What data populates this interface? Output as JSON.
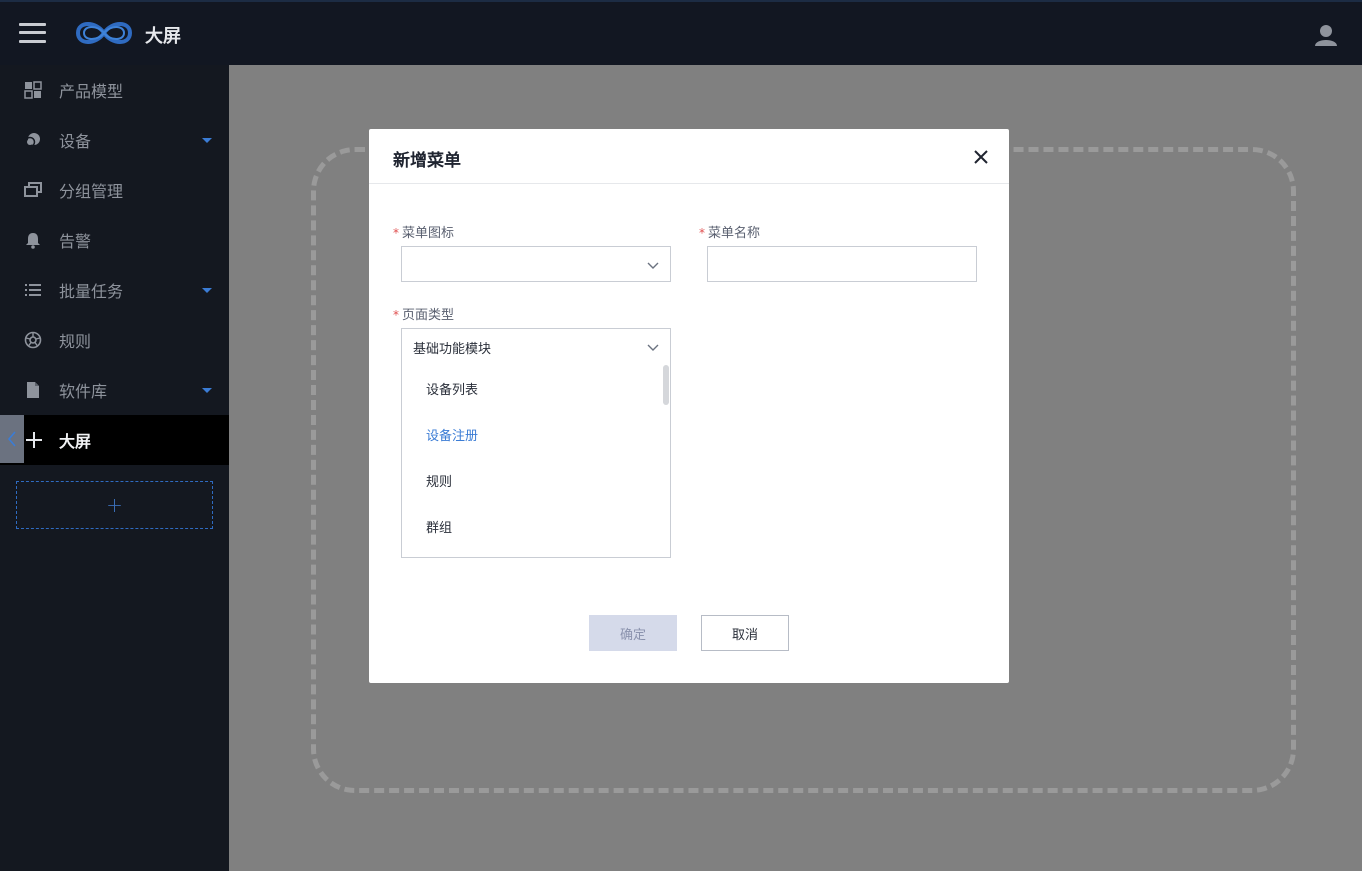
{
  "header": {
    "brand": "大屏",
    "menu_icon": "hamburger-icon",
    "logo_icon": "infinity-logo-icon",
    "user_icon": "user-avatar-icon"
  },
  "sidebar": {
    "items": [
      {
        "label": "产品模型",
        "icon": "grid-icon",
        "has_submenu": false
      },
      {
        "label": "设备",
        "icon": "device-icon",
        "has_submenu": true
      },
      {
        "label": "分组管理",
        "icon": "group-icon",
        "has_submenu": false
      },
      {
        "label": "告警",
        "icon": "bell-icon",
        "has_submenu": false
      },
      {
        "label": "批量任务",
        "icon": "list-icon",
        "has_submenu": true
      },
      {
        "label": "规则",
        "icon": "rule-icon",
        "has_submenu": false
      },
      {
        "label": "软件库",
        "icon": "file-icon",
        "has_submenu": true
      },
      {
        "label": "大屏",
        "icon": "plus-icon",
        "has_submenu": false,
        "active": true
      }
    ],
    "add_label": "+",
    "collapse_icon": "chevron-left-icon"
  },
  "modal": {
    "title": "新增菜单",
    "fields": {
      "menu_icon": {
        "label": "菜单图标",
        "required": true,
        "value": ""
      },
      "menu_name": {
        "label": "菜单名称",
        "required": true,
        "value": "",
        "placeholder": ""
      },
      "page_type": {
        "label": "页面类型",
        "required": true,
        "value": "基础功能模块"
      }
    },
    "dropdown_options": [
      {
        "label": "设备列表",
        "selected": false
      },
      {
        "label": "设备注册",
        "selected": true
      },
      {
        "label": "规则",
        "selected": false
      },
      {
        "label": "群组",
        "selected": false
      }
    ],
    "buttons": {
      "confirm": "确定",
      "cancel": "取消"
    }
  },
  "colors": {
    "accent": "#3b7cd5",
    "header_bg": "#121722",
    "sidebar_bg": "#141820",
    "overlay": "#808080"
  }
}
